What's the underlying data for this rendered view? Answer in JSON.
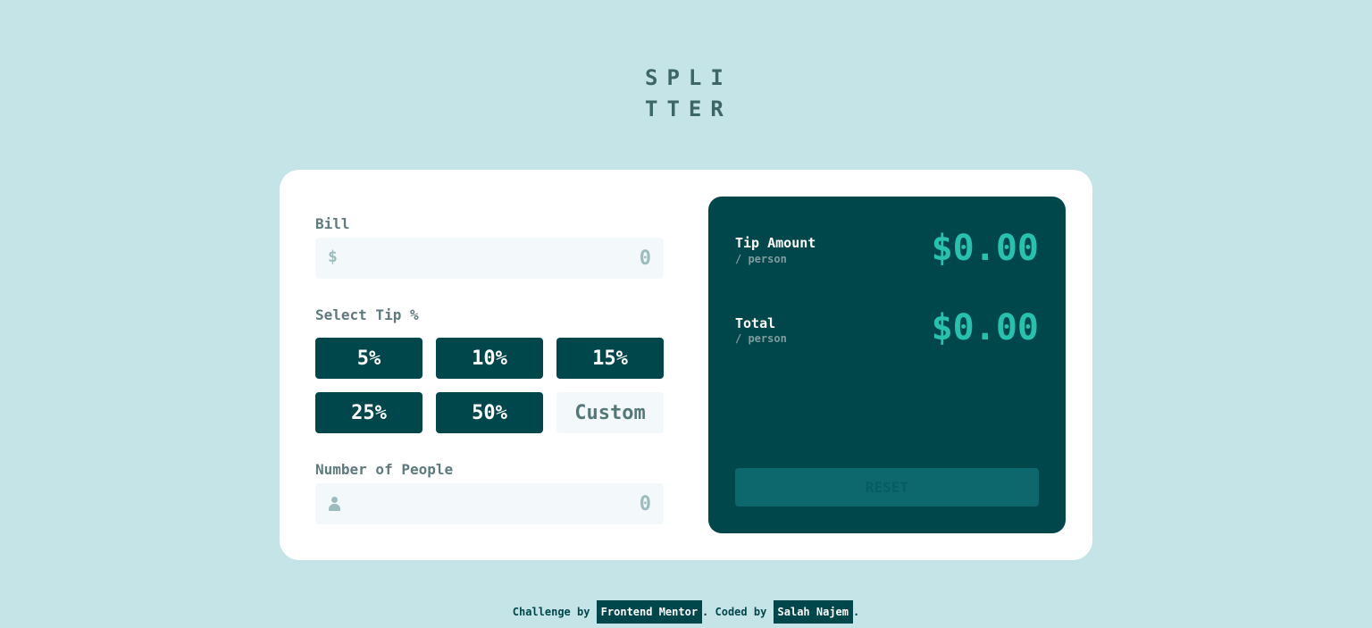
{
  "logo": {
    "line1": "SPLI",
    "line2": "TTER"
  },
  "bill": {
    "label": "Bill",
    "currency_symbol": "$",
    "placeholder": "0"
  },
  "tip": {
    "label": "Select Tip %",
    "options": [
      "5%",
      "10%",
      "15%",
      "25%",
      "50%"
    ],
    "custom_placeholder": "Custom"
  },
  "people": {
    "label": "Number of People",
    "placeholder": "0",
    "icon": "person-icon"
  },
  "result": {
    "tip_amount": {
      "title": "Tip Amount",
      "sub": "/ person",
      "value": "$0.00"
    },
    "total": {
      "title": "Total",
      "sub": "/ person",
      "value": "$0.00"
    },
    "reset_label": "RESET"
  },
  "footer": {
    "prefix": "Challenge by ",
    "link1": "Frontend Mentor",
    "middle": ". Coded by ",
    "link2": "Salah Najem",
    "suffix": "."
  },
  "colors": {
    "background": "#c5e4e7",
    "dark_cyan": "#00474b",
    "accent": "#26c2ae",
    "input_bg": "#f3f9fa"
  }
}
